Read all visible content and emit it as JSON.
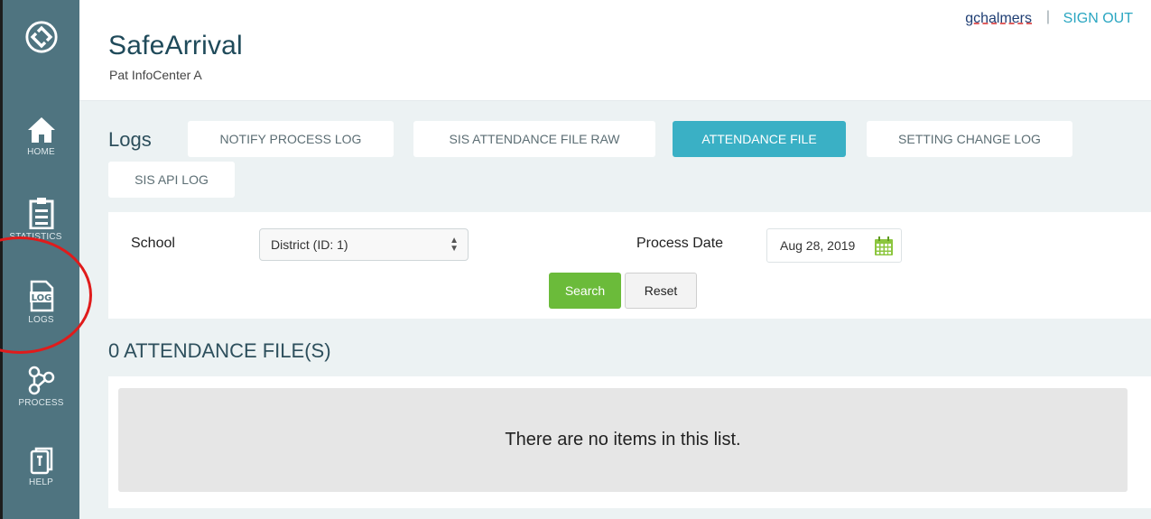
{
  "sidebar": {
    "items": [
      {
        "label": "HOME",
        "icon": "home-icon"
      },
      {
        "label": "STATISTICS",
        "icon": "clipboard-icon"
      },
      {
        "label": "LOGS",
        "icon": "log-file-icon"
      },
      {
        "label": "PROCESS",
        "icon": "process-nodes-icon"
      },
      {
        "label": "HELP",
        "icon": "help-book-icon"
      }
    ]
  },
  "header": {
    "title": "SafeArrival",
    "subtitle": "Pat InfoCenter A",
    "username": "gchalmers",
    "separator": "|",
    "signout": "SIGN OUT"
  },
  "logs": {
    "title": "Logs",
    "tabs": [
      {
        "label": "NOTIFY PROCESS LOG",
        "active": false
      },
      {
        "label": "SIS ATTENDANCE FILE RAW",
        "active": false
      },
      {
        "label": "ATTENDANCE FILE",
        "active": true
      },
      {
        "label": "SETTING CHANGE LOG",
        "active": false
      },
      {
        "label": "SIS API LOG",
        "active": false
      }
    ]
  },
  "filters": {
    "school_label": "School",
    "school_value": "District (ID: 1)",
    "date_label": "Process Date",
    "date_value": "Aug 28, 2019",
    "search_label": "Search",
    "reset_label": "Reset"
  },
  "results": {
    "title": "0 ATTENDANCE FILE(S)",
    "empty_message": "There are no items in this list."
  },
  "colors": {
    "sidebar": "#4f7480",
    "accent": "#3ab0c5",
    "search_button": "#6bbb3a",
    "annotation": "#e01b1b"
  }
}
